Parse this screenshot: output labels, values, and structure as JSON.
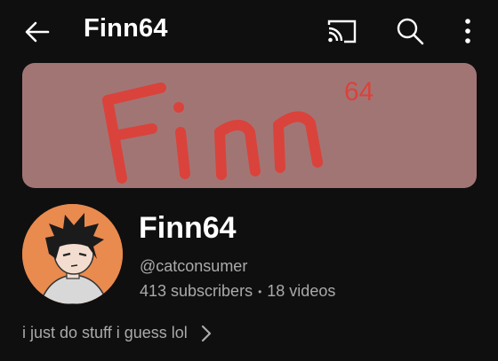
{
  "header": {
    "title": "Finn64",
    "icons": [
      "back-arrow-icon",
      "cast-icon",
      "search-icon",
      "more-vert-icon"
    ]
  },
  "banner": {
    "text": "Finn",
    "superscript": "64",
    "bg_color": "#a27575",
    "text_color": "#d9433b"
  },
  "channel": {
    "name": "Finn64",
    "handle": "@catconsumer",
    "subscribers": "413 subscribers",
    "separator": "•",
    "videos": "18 videos",
    "description": "i just do stuff i guess lol"
  },
  "colors": {
    "background": "#0f0f0f",
    "primary_text": "#ffffff",
    "secondary_text": "#aaaaaa",
    "avatar_bg": "#e98a4f"
  }
}
